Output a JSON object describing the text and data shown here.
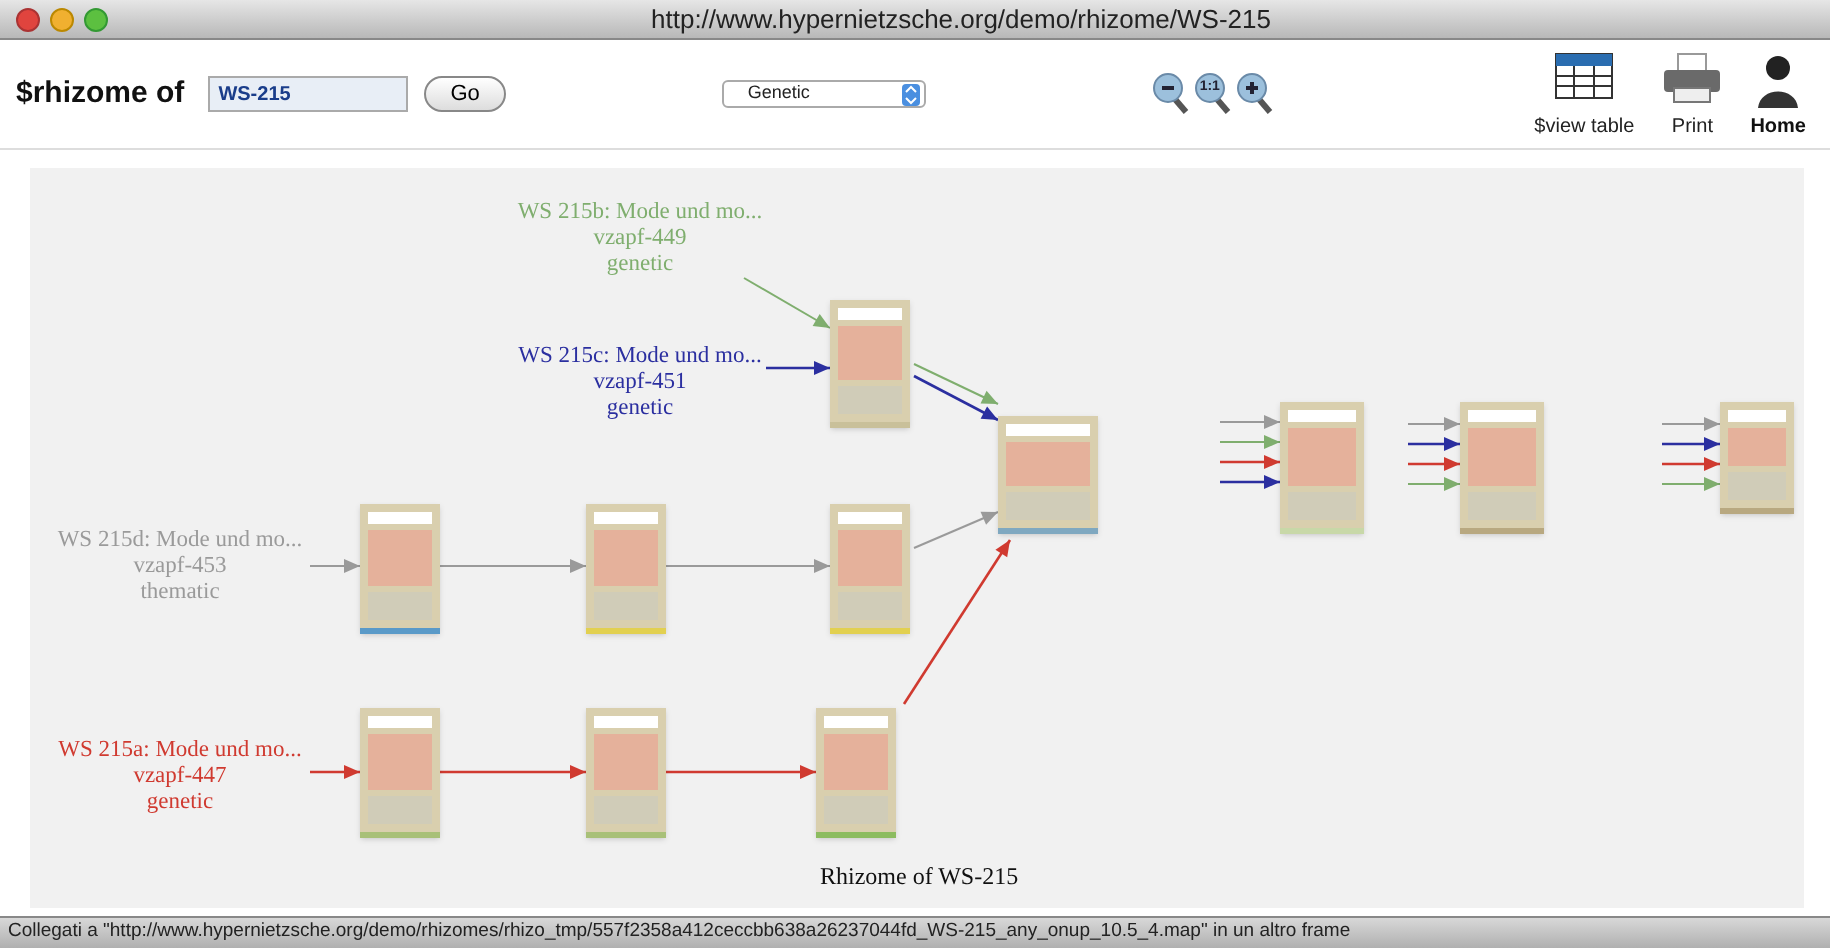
{
  "window": {
    "title": "http://www.hypernietzsche.org/demo/rhizome/WS-215"
  },
  "toolbar": {
    "label": "$rhizome of",
    "search": {
      "value": "WS-215"
    },
    "go_button": "Go",
    "view_select": {
      "value": "Genetic"
    },
    "zoom_reset": "1:1",
    "actions": [
      {
        "kind": "table",
        "label": "$view table"
      },
      {
        "kind": "print",
        "label": "Print"
      },
      {
        "kind": "home",
        "label": "Home"
      }
    ]
  },
  "diagram": {
    "sources": [
      {
        "title": "WS 215b: Mode und mo...",
        "id": "vzapf-449",
        "relation": "genetic",
        "color": "#7fae6e"
      },
      {
        "title": "WS 215c: Mode und mo...",
        "id": "vzapf-451",
        "relation": "genetic",
        "color": "#2b2fa0"
      },
      {
        "title": "WS 215d: Mode und mo...",
        "id": "vzapf-453",
        "relation": "thematic",
        "color": "#9a9a9a"
      },
      {
        "title": "WS 215a: Mode und mo...",
        "id": "vzapf-447",
        "relation": "genetic",
        "color": "#d03a30"
      }
    ],
    "caption": "Rhizome of WS-215"
  },
  "status_bar": "Collegati a \"http://www.hypernietzsche.org/demo/rhizomes/rhizo_tmp/557f2358a412ceccbb638a26237044fd_WS-215_any_onup_10.5_4.map\" in un altro frame"
}
